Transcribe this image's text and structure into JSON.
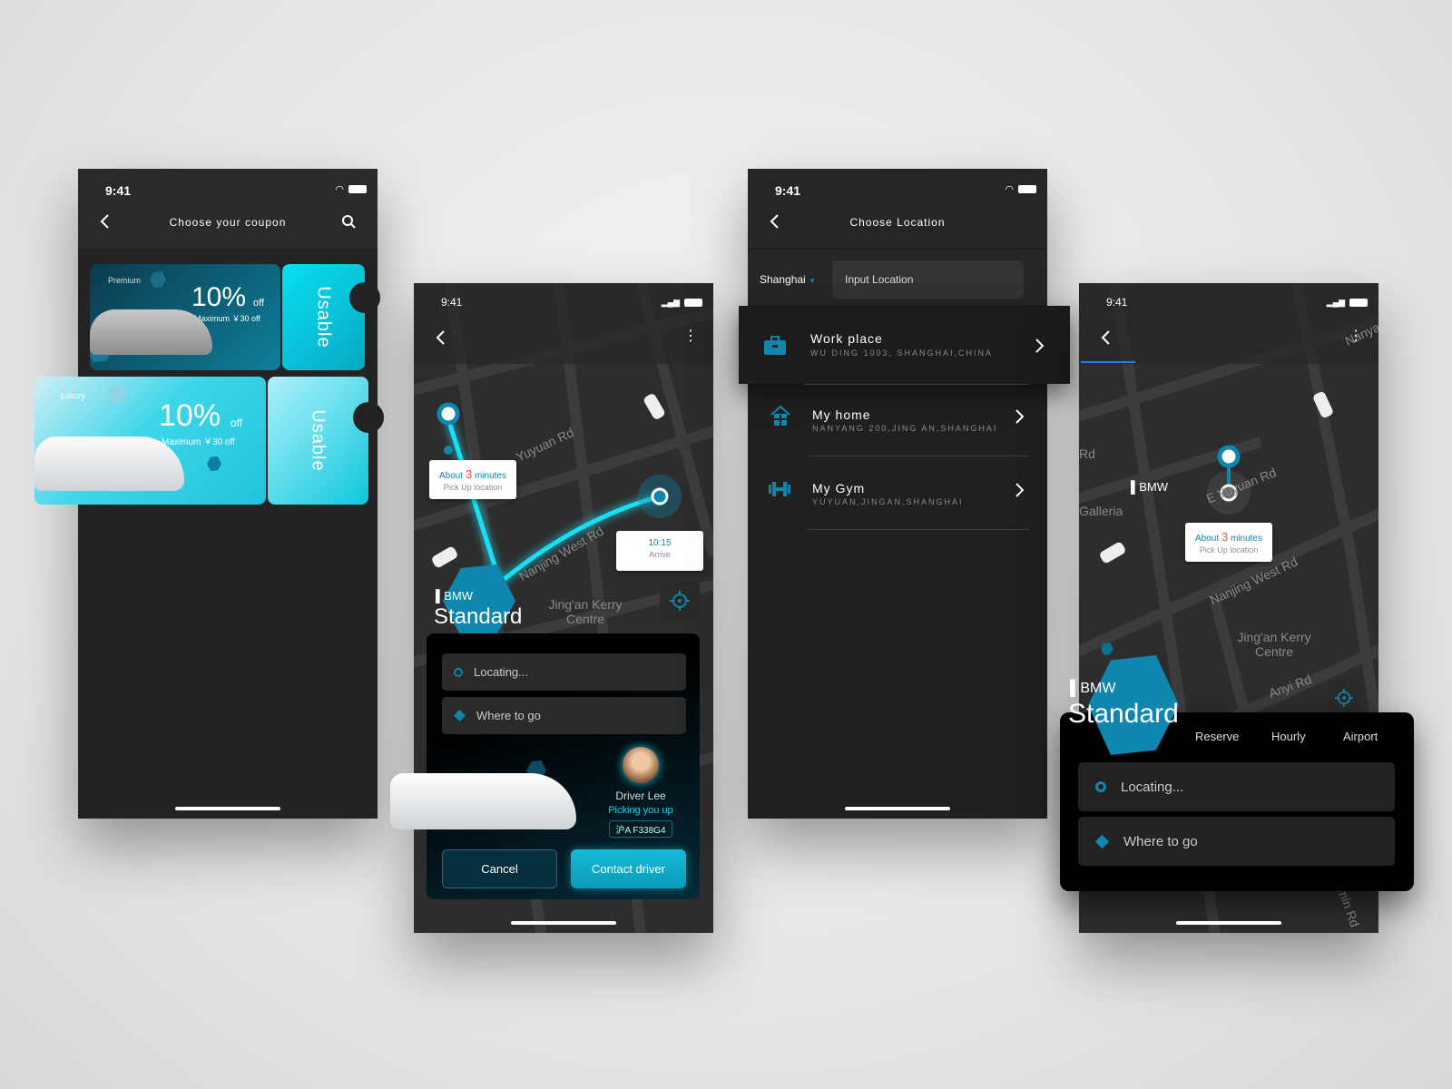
{
  "accent": "#0e86ad",
  "route_color": "#16e0f5",
  "status_time": "9:41",
  "coupon_screen": {
    "title": "Choose your coupon",
    "coupons": [
      {
        "tier": "Premium",
        "discount": "10%",
        "off": "off",
        "max": "Maximum ￥30 off",
        "status": "Usable"
      },
      {
        "tier": "Luxury",
        "discount": "10%",
        "off": "off",
        "max": "Maximum ￥30 off",
        "status": "Usable"
      }
    ]
  },
  "ride_screen": {
    "map_labels": [
      "Yuyuan Rd",
      "Nanjing West Rd",
      "Jing'an Kerry Centre"
    ],
    "pickup": {
      "prefix": "About",
      "minutes": "3",
      "suffix": "minutes",
      "label": "Pick Up location"
    },
    "arrive": {
      "time": "10:15",
      "label": "Arrive"
    },
    "brand": "BMW",
    "car_class": "Standard",
    "locating": "Locating...",
    "destination_placeholder": "Where to go",
    "driver": {
      "name": "Driver Lee",
      "status": "Picking you up",
      "plate": "沪A F338G4"
    },
    "cancel": "Cancel",
    "contact": "Contact driver"
  },
  "location_screen": {
    "title": "Choose Location",
    "city": "Shanghai",
    "input_placeholder": "Input Location",
    "places": [
      {
        "name": "Work place",
        "address": "WU DING 1003,  SHANGHAI,CHINA",
        "icon": "briefcase-icon"
      },
      {
        "name": "My home",
        "address": "NANYANG 200,JING AN,SHANGHAI",
        "icon": "home-icon"
      },
      {
        "name": "My Gym",
        "address": "YUYUAN,JINGAN,SHANGHAI",
        "icon": "dumbbell-icon"
      }
    ]
  },
  "booking_screen": {
    "map_labels": [
      "Nanya",
      "Rd",
      "Galleria",
      "E Yuyuan Rd",
      "Nanjing West Rd",
      "Jing'an Kerry Centre",
      "Anyi Rd",
      "min Rd"
    ],
    "map_brand": "BMW",
    "pickup": {
      "prefix": "About",
      "minutes": "3",
      "suffix": "minutes",
      "label": "Pick Up location"
    },
    "brand": "BMW",
    "car_class": "Standard",
    "tabs": [
      "Reserve",
      "Hourly",
      "Airport"
    ],
    "locating": "Locating...",
    "destination_placeholder": "Where to go"
  }
}
